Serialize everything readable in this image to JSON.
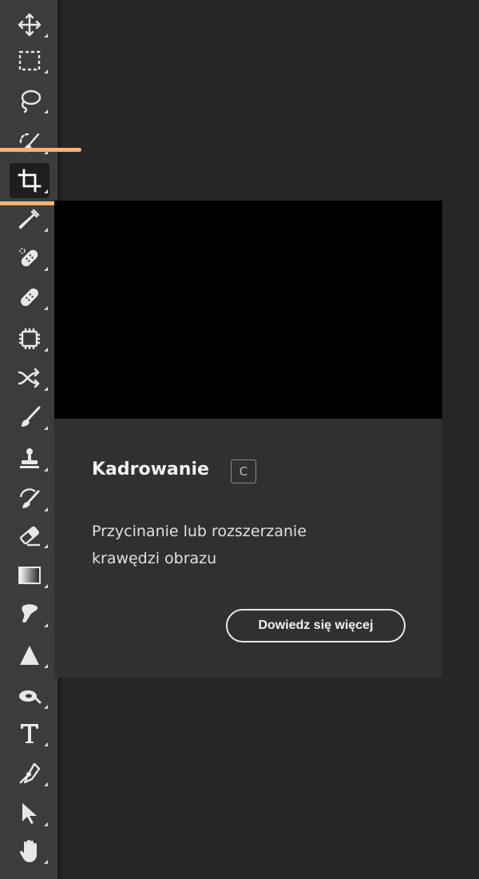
{
  "toolbar": {
    "tools": [
      {
        "name": "move-tool",
        "icon": "move-icon"
      },
      {
        "name": "marquee-tool",
        "icon": "rectangular-marquee-icon"
      },
      {
        "name": "lasso-tool",
        "icon": "lasso-icon"
      },
      {
        "name": "quick-selection-tool",
        "icon": "quick-selection-brush-icon"
      },
      {
        "name": "crop-tool",
        "icon": "crop-icon",
        "active": true
      },
      {
        "name": "eyedropper-tool",
        "icon": "eyedropper-icon"
      },
      {
        "name": "spot-healing-tool",
        "icon": "spot-healing-bandage-icon"
      },
      {
        "name": "healing-brush-tool",
        "icon": "bandage-icon"
      },
      {
        "name": "content-aware-tool",
        "icon": "patch-icon"
      },
      {
        "name": "content-aware-move-tool",
        "icon": "crossing-arrows-icon"
      },
      {
        "name": "brush-tool",
        "icon": "brush-icon"
      },
      {
        "name": "clone-stamp-tool",
        "icon": "stamp-icon"
      },
      {
        "name": "history-brush-tool",
        "icon": "history-brush-icon"
      },
      {
        "name": "eraser-tool",
        "icon": "eraser-icon"
      },
      {
        "name": "gradient-tool",
        "icon": "gradient-icon"
      },
      {
        "name": "smudge-tool",
        "icon": "smudge-icon"
      },
      {
        "name": "sharpen-tool",
        "icon": "triangle-icon"
      },
      {
        "name": "dodge-tool",
        "icon": "dodge-icon"
      },
      {
        "name": "type-tool",
        "icon": "type-icon"
      },
      {
        "name": "pen-tool",
        "icon": "pen-icon"
      },
      {
        "name": "path-selection-tool",
        "icon": "arrow-pointer-icon"
      },
      {
        "name": "hand-tool",
        "icon": "hand-icon"
      }
    ]
  },
  "flyout": {
    "title": "Kadrowanie",
    "shortcut": "C",
    "description_line1": "Przycinanie lub rozszerzanie",
    "description_line2": "krawędzi obrazu",
    "learn_more": "Dowiedz się więcej"
  },
  "colors": {
    "highlight": "#f0b27a",
    "toolbar": "#3c3c3c",
    "canvas": "#262626",
    "flyout": "#303030"
  }
}
